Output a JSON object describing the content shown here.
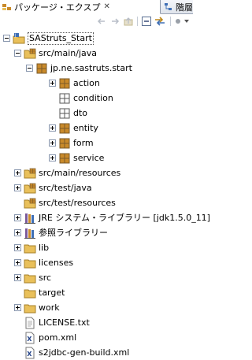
{
  "tabs": {
    "active_label": "パッケージ・エクスプ",
    "inactive_label": "階層"
  },
  "toolbar": {
    "icons": [
      "back-arrow-icon",
      "forward-arrow-icon",
      "up-folder-icon",
      "collapse-all-icon",
      "link-with-editor-icon",
      "view-menu-icon"
    ]
  },
  "tree": {
    "root": {
      "label": "SAStruts_Start",
      "icon": "java-project-icon",
      "expanded": true
    },
    "src_main_java": {
      "label": "src/main/java",
      "icon": "source-folder-icon",
      "expanded": true
    },
    "package_root": {
      "label": "jp.ne.sastruts.start",
      "icon": "package-icon",
      "expanded": true
    },
    "packages": [
      {
        "label": "action",
        "icon": "package-icon",
        "toggle": "plus"
      },
      {
        "label": "condition",
        "icon": "package-empty-icon",
        "toggle": "none"
      },
      {
        "label": "dto",
        "icon": "package-empty-icon",
        "toggle": "none"
      },
      {
        "label": "entity",
        "icon": "package-icon",
        "toggle": "plus"
      },
      {
        "label": "form",
        "icon": "package-icon",
        "toggle": "plus"
      },
      {
        "label": "service",
        "icon": "package-icon",
        "toggle": "plus"
      }
    ],
    "source_folders": [
      {
        "label": "src/main/resources",
        "icon": "source-folder-icon",
        "toggle": "plus"
      },
      {
        "label": "src/test/java",
        "icon": "source-folder-icon",
        "toggle": "plus"
      },
      {
        "label": "src/test/resources",
        "icon": "source-folder-icon",
        "toggle": "none"
      }
    ],
    "libraries": [
      {
        "label": "JRE システム・ライブラリー [jdk1.5.0_11]",
        "icon": "library-icon",
        "toggle": "plus"
      },
      {
        "label": "参照ライブラリー",
        "icon": "library-icon",
        "toggle": "plus"
      }
    ],
    "folders": [
      {
        "label": "lib",
        "icon": "folder-icon",
        "toggle": "plus"
      },
      {
        "label": "licenses",
        "icon": "folder-icon",
        "toggle": "plus"
      },
      {
        "label": "src",
        "icon": "folder-icon",
        "toggle": "plus"
      },
      {
        "label": "target",
        "icon": "folder-icon",
        "toggle": "none"
      },
      {
        "label": "work",
        "icon": "folder-icon",
        "toggle": "plus"
      }
    ],
    "files": [
      {
        "label": "LICENSE.txt",
        "icon": "text-file-icon"
      },
      {
        "label": "pom.xml",
        "icon": "xml-file-icon"
      },
      {
        "label": "s2jdbc-gen-build.xml",
        "icon": "xml-file-icon"
      }
    ]
  },
  "colors": {
    "package": "#c98a2a",
    "folder": "#e9c05a",
    "source_folder_badge": "#7a5a2a",
    "project": "#3f6fb5"
  }
}
